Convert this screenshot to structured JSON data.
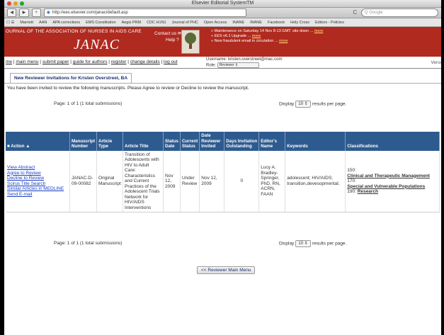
{
  "window": {
    "title": "Elsevier Editorial SystemTM"
  },
  "toolbar": {
    "back": "◀",
    "forward": "▶",
    "add": "+",
    "url": "http://ees.elsevier.com/janac/default.asp",
    "reload": "C",
    "search_placeholder": "Google"
  },
  "bookmarks": [
    "Marriott",
    "AAN",
    "APA corrections",
    "EMS Constitution",
    "Aegis PRM",
    "CDC H1N1",
    "Journal of PHC",
    "Open Access",
    "INANE",
    "INANE",
    "Facebook",
    "Holy Cross",
    "Editors - Policies"
  ],
  "banner": {
    "journal_name": "OURNAL OF THE ASSOCIATION OF NURSES IN AIDS CARE",
    "logo_text": "JANAC",
    "contact_label": "Contact us",
    "help_label": "Help ?",
    "publisher_logo_text": "ELSEVIER",
    "announcements": [
      {
        "text": "» Maintenance on Saturday 14 Nov 8-13 GMT: site down ...",
        "link": "more"
      },
      {
        "text": "» EES v6.1 Upgrade ...",
        "link": "more"
      },
      {
        "text": "» New fraudulent email in circulation ...",
        "link": "more"
      }
    ]
  },
  "nav": {
    "links": [
      "me",
      "main menu",
      "submit paper",
      "guide for authors",
      "register",
      "change details",
      "log out"
    ],
    "username_label": "Username:",
    "username": "kristen.overstreet@mac.com",
    "role_label": "Role:",
    "role": "Reviewer",
    "version": "Versi"
  },
  "tab": {
    "label": "New Reviewer Invitations for Kristen Overstreet, BA"
  },
  "intro": "You have been invited to review the following manuscripts. Please Agree to review or Decline to review the manuscript.",
  "pagination": {
    "text": "Page: 1 of 1 (1 total submissions)"
  },
  "display": {
    "label": "Display",
    "value": "10",
    "suffix": "results per page."
  },
  "table": {
    "headers": {
      "action": "Action ▲",
      "manuscript_number": "Manuscript Number",
      "article_type": "Article Type",
      "article_title": "Article Title",
      "status_date": "Status Date",
      "current_status": "Current Status",
      "date_invited": "Date Reviewer Invited",
      "days_outstanding": "Days Invitation Outstanding",
      "editor_name": "Editor's Name",
      "keywords": "Keywords",
      "classifications": "Classifications"
    },
    "rows": [
      {
        "actions": [
          "View Abstract",
          "Agree to Review",
          "Decline to Review",
          "Scirus Title Search",
          "Similar Articles in MEDLINE",
          "Send E-mail"
        ],
        "manuscript_number": "JANAC-D-09-00082",
        "article_type": "Original Manuscript",
        "article_title": "Transition of Adolescents with HIV to Adult Care: Characteristics and Current Practices of the Adolescent Trials Network for HIV/AIDS Interventions",
        "status_date": "Nov 12, 2009",
        "current_status": "Under Review",
        "date_invited": "Nov 12, 2009",
        "days_outstanding": "0",
        "editor_name": "Lucy A. Bradley-Springer, PhD, RN, ACRN, FAAN",
        "keywords": "adolescent; HIV/AIDS; transition,devesopmental;",
        "classifications": [
          {
            "code": "150:",
            "label": "Clinical and Therapeutic Management"
          },
          {
            "code": "170:",
            "label": "Special and Vulnerable Populations"
          },
          {
            "code": "190:",
            "label": "Research"
          }
        ]
      }
    ]
  },
  "main_menu_button": "<< Reviewer Main Menu"
}
